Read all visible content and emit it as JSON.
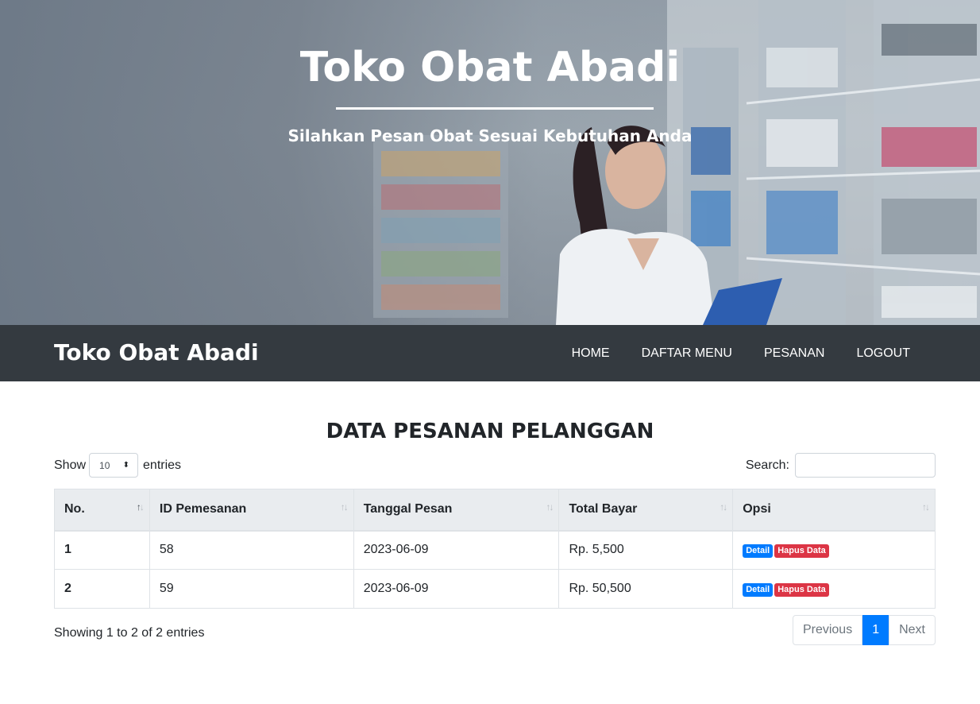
{
  "hero": {
    "title": "Toko Obat Abadi",
    "subtitle": "Silahkan Pesan Obat Sesuai Kebutuhan Anda"
  },
  "navbar": {
    "brand": "Toko Obat Abadi",
    "links": [
      "HOME",
      "DAFTAR MENU",
      "PESANAN",
      "LOGOUT"
    ]
  },
  "main": {
    "title": "DATA PESANAN PELANGGAN",
    "show_label": "Show",
    "entries_label": "entries",
    "page_length": "10",
    "search_label": "Search:",
    "search_value": "",
    "table": {
      "columns": [
        "No.",
        "ID Pemesanan",
        "Tanggal Pesan",
        "Total Bayar",
        "Opsi"
      ],
      "rows": [
        {
          "no": "1",
          "id": "58",
          "date": "2023-06-09",
          "total": "Rp. 5,500",
          "detail": "Detail",
          "delete": "Hapus Data"
        },
        {
          "no": "2",
          "id": "59",
          "date": "2023-06-09",
          "total": "Rp. 50,500",
          "detail": "Detail",
          "delete": "Hapus Data"
        }
      ]
    },
    "info": "Showing 1 to 2 of 2 entries",
    "pagination": {
      "previous": "Previous",
      "current": "1",
      "next": "Next"
    }
  },
  "colors": {
    "navbar": "#343a40",
    "primary": "#007bff",
    "danger": "#dc3545",
    "table_header": "#e9ecef"
  }
}
